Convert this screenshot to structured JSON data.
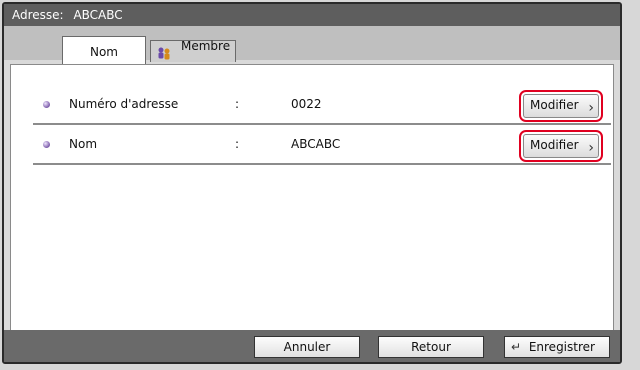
{
  "header": {
    "label": "Adresse:",
    "value": "ABCABC"
  },
  "tabs": [
    {
      "label": "Nom",
      "active": true
    },
    {
      "label": "Membre",
      "active": false,
      "icon": "people-icon"
    }
  ],
  "rows": [
    {
      "label": "Numéro d'adresse",
      "colon": ":",
      "value": "0022",
      "button_label": "Modifier",
      "chevron": "›"
    },
    {
      "label": "Nom",
      "colon": ":",
      "value": "ABCABC",
      "button_label": "Modifier",
      "chevron": "›"
    }
  ],
  "footer": {
    "cancel_label": "Annuler",
    "back_label": "Retour",
    "save_label": "Enregistrer",
    "save_icon": "enter-arrow-icon"
  },
  "colors": {
    "highlight": "#e00020",
    "topbar": "#5e5e5e",
    "bottombar": "#6a6a6a"
  }
}
